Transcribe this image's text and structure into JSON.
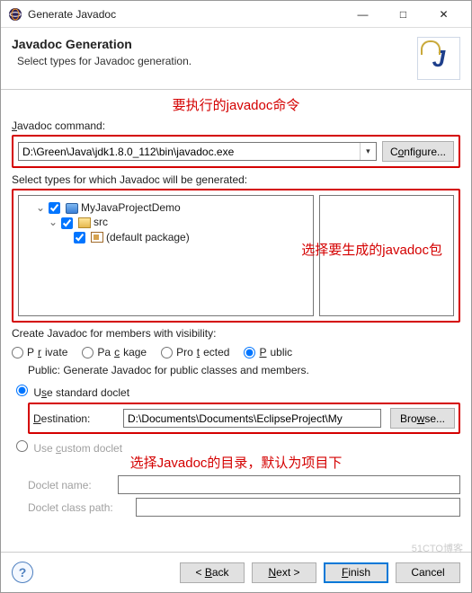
{
  "titlebar": {
    "title": "Generate Javadoc"
  },
  "banner": {
    "heading": "Javadoc Generation",
    "sub": "Select types for Javadoc generation."
  },
  "cmd": {
    "label": "Javadoc command:",
    "u": "J",
    "value": "D:\\Green\\Java\\jdk1.8.0_112\\bin\\javadoc.exe",
    "configure": "Configure...",
    "configure_u": "o"
  },
  "types": {
    "label": "Select types for which Javadoc will be generated:",
    "tree": {
      "proj": "MyJavaProjectDemo",
      "src": "src",
      "pkg": "(default package)"
    }
  },
  "visibility": {
    "label": "Create Javadoc for members with visibility:",
    "options": [
      "Private",
      "Package",
      "Protected",
      "Public"
    ],
    "underlines": [
      "r",
      "c",
      "t",
      "P"
    ],
    "selected": 3,
    "desc": "Public: Generate Javadoc for public classes and members."
  },
  "doclet": {
    "std": "Use standard doclet",
    "std_u": "s",
    "dest_label": "Destination:",
    "dest_u": "D",
    "dest_value": "D:\\Documents\\Documents\\EclipseProject\\My",
    "browse": "Browse...",
    "browse_u": "w",
    "custom": "Use custom doclet",
    "custom_u": "c",
    "name_label": "Doclet name:",
    "path_label": "Doclet class path:"
  },
  "annot": {
    "a1": "要执行的javadoc命令",
    "a2": "选择要生成的javadoc包",
    "a3": "选择Javadoc的目录，默认为项目下"
  },
  "footer": {
    "back": "< Back",
    "next": "Next >",
    "finish": "Finish",
    "cancel": "Cancel"
  },
  "watermark": "51CTO博客"
}
